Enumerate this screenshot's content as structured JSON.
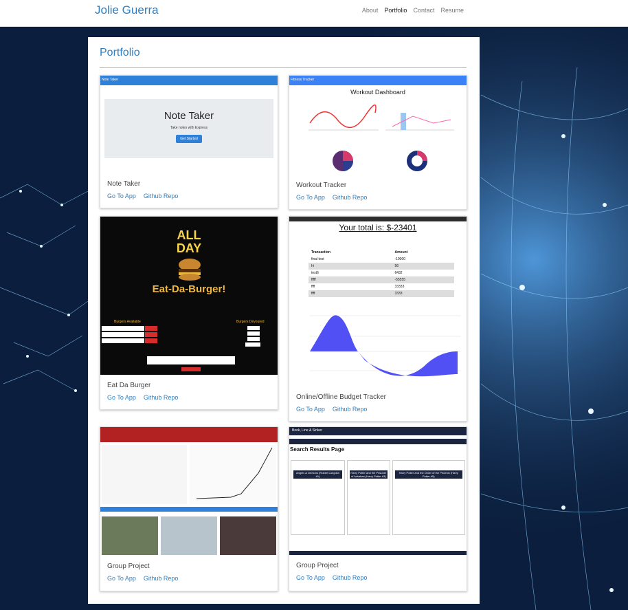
{
  "brand": "Jolie Guerra",
  "nav": [
    "About",
    "Portfolio",
    "Contact",
    "Resume"
  ],
  "nav_active": "Portfolio",
  "section_title": "Portfolio",
  "link_app": "Go To App",
  "link_repo": "Github Repo",
  "cards": [
    {
      "title": "Note Taker",
      "header": "Note Taker",
      "heading": "Note Taker",
      "sub": "Take notes with Express",
      "button": "Get Started"
    },
    {
      "title": "Workout Tracker",
      "header": "Fitness Tracker",
      "heading": "Workout Dashboard"
    },
    {
      "title": "Eat Da Burger",
      "neon_top": "ALL",
      "neon_bottom": "DAY",
      "heading": "Eat-Da-Burger!",
      "left_list": "Burgers Available",
      "right_list": "Burgers Devoured"
    },
    {
      "title": "Online/Offline Budget Tracker",
      "heading": "Your total is: $-23401",
      "table_head": [
        "Transaction",
        "Amount"
      ],
      "rows": [
        [
          "final test",
          "-10000"
        ],
        [
          "hi",
          "56"
        ],
        [
          "test6",
          "6432"
        ],
        [
          "fffff",
          "-55555"
        ],
        [
          "ffff",
          "33333"
        ],
        [
          "ffff",
          "3333"
        ]
      ]
    },
    {
      "title": "Group Project"
    },
    {
      "title": "Group Project",
      "brand": "Book, Line & Sinker",
      "heading": "Search Results Page",
      "books": [
        "Angels & Demons (Robert Langdon #1)",
        "Harry Potter and the Prisoner of Azkaban (Harry Potter #3)",
        "Harry Potter and the Order of the Phoenix (Harry Potter #5)"
      ]
    }
  ],
  "colors": {
    "accent": "#2f7fc1",
    "background": "#0b1e3d"
  }
}
